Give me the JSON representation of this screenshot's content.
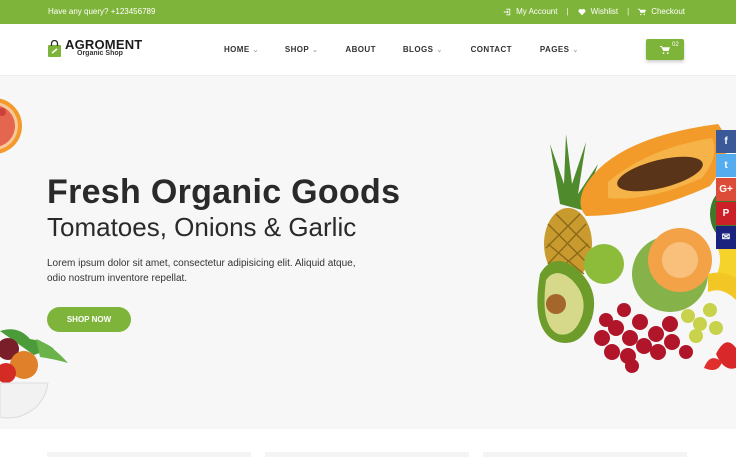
{
  "topbar": {
    "query": "Have any query? +123456789",
    "account": "My Account",
    "wishlist": "Wishlist",
    "checkout": "Checkout",
    "separator": "|"
  },
  "logo": {
    "main": "AGROMENT",
    "sub": "Organic Shop"
  },
  "nav": {
    "home": "HOME",
    "shop": "SHOP",
    "about": "ABOUT",
    "blogs": "BLOGS",
    "contact": "CONTACT",
    "pages": "PAGES",
    "chevron": "⌄"
  },
  "cart": {
    "count": "02"
  },
  "hero": {
    "title": "Fresh Organic Goods",
    "subtitle": "Tomatoes, Onions & Garlic",
    "text": "Lorem ipsum dolor sit amet, consectetur adipisicing elit. Aliquid atque, odio nostrum inventore repellat.",
    "button": "SHOP NOW"
  },
  "social": {
    "facebook": "f",
    "twitter": "t",
    "google": "G+",
    "pinterest": "P",
    "email": "✉"
  },
  "colors": {
    "brand": "#7fb43a",
    "facebook": "#3b5998",
    "twitter": "#55acee",
    "google": "#dd4b39",
    "pinterest": "#cb2027",
    "email": "#1a237e"
  }
}
